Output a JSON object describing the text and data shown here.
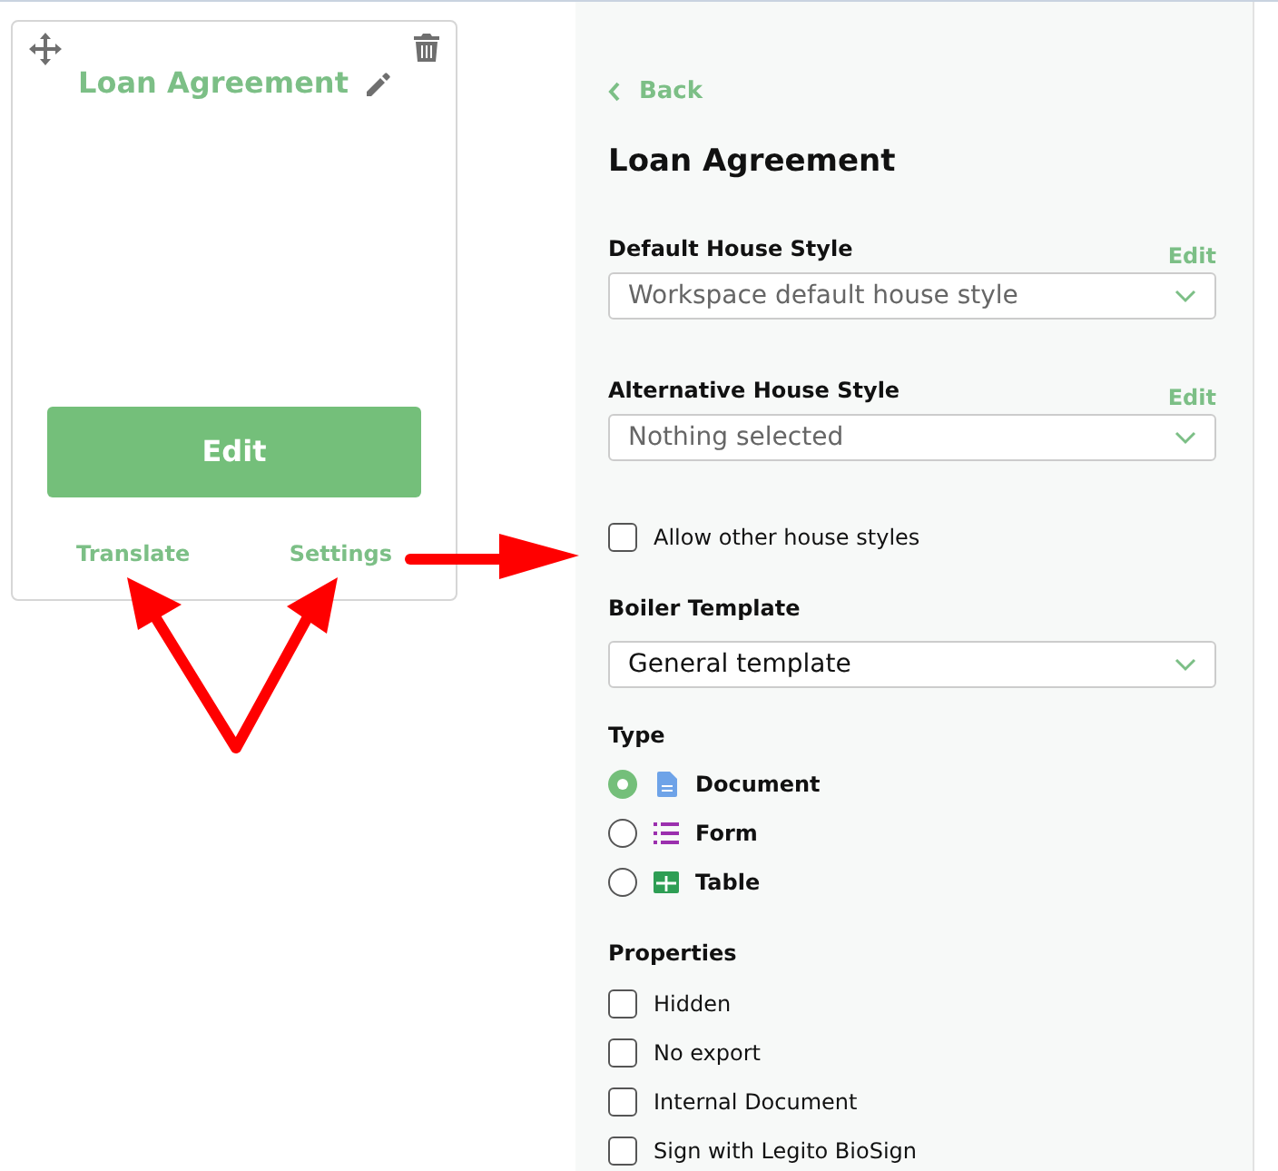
{
  "card": {
    "title": "Loan Agreement",
    "edit_button": "Edit",
    "links": [
      "Translate",
      "Settings"
    ]
  },
  "panel": {
    "back": "Back",
    "title": "Loan Agreement",
    "selects": [
      {
        "label": "Default House Style",
        "edit": "Edit",
        "value": "Workspace default house style",
        "muted": true
      },
      {
        "label": "Alternative House Style",
        "edit": "Edit",
        "value": "Nothing selected",
        "muted": true
      }
    ],
    "allow_other": {
      "label": "Allow other house styles",
      "checked": false
    },
    "boiler": {
      "label": "Boiler Template",
      "value": "General template"
    },
    "type": {
      "label": "Type",
      "options": [
        {
          "kind": "document",
          "label": "Document",
          "selected": true
        },
        {
          "kind": "form",
          "label": "Form",
          "selected": false
        },
        {
          "kind": "table",
          "label": "Table",
          "selected": false
        }
      ]
    },
    "properties": {
      "label": "Properties",
      "items": [
        {
          "label": "Hidden",
          "checked": false
        },
        {
          "label": "No export",
          "checked": false
        },
        {
          "label": "Internal Document",
          "checked": false
        },
        {
          "label": "Sign with Legito BioSign",
          "checked": false
        }
      ]
    }
  }
}
